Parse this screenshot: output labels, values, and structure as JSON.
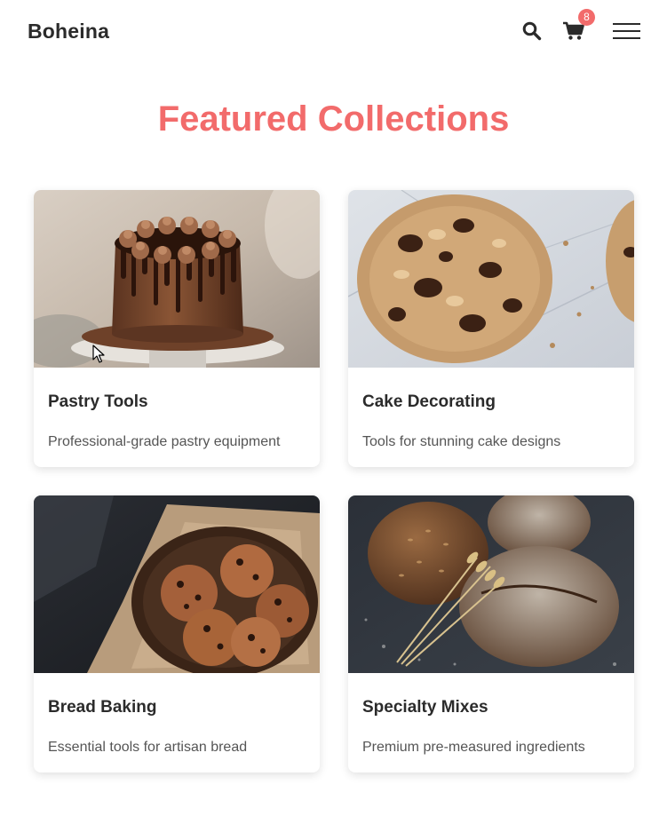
{
  "header": {
    "logo": "Boheina",
    "cart_count": "8",
    "icons": [
      "search-icon",
      "cart-icon",
      "hamburger-menu-icon"
    ]
  },
  "main": {
    "title": "Featured Collections",
    "collections": [
      {
        "title": "Pastry Tools",
        "description": "Professional-grade pastry equipment",
        "image": "chocolate-drip-cake"
      },
      {
        "title": "Cake Decorating",
        "description": "Tools for stunning cake designs",
        "image": "chocolate-chip-cookies"
      },
      {
        "title": "Bread Baking",
        "description": "Essential tools for artisan bread",
        "image": "cookies-in-basket"
      },
      {
        "title": "Specialty Mixes",
        "description": "Premium pre-measured ingredients",
        "image": "rustic-bread-loaves"
      }
    ]
  },
  "colors": {
    "accent": "#f26b6b",
    "text": "#2b2b2b",
    "muted": "#555555"
  }
}
